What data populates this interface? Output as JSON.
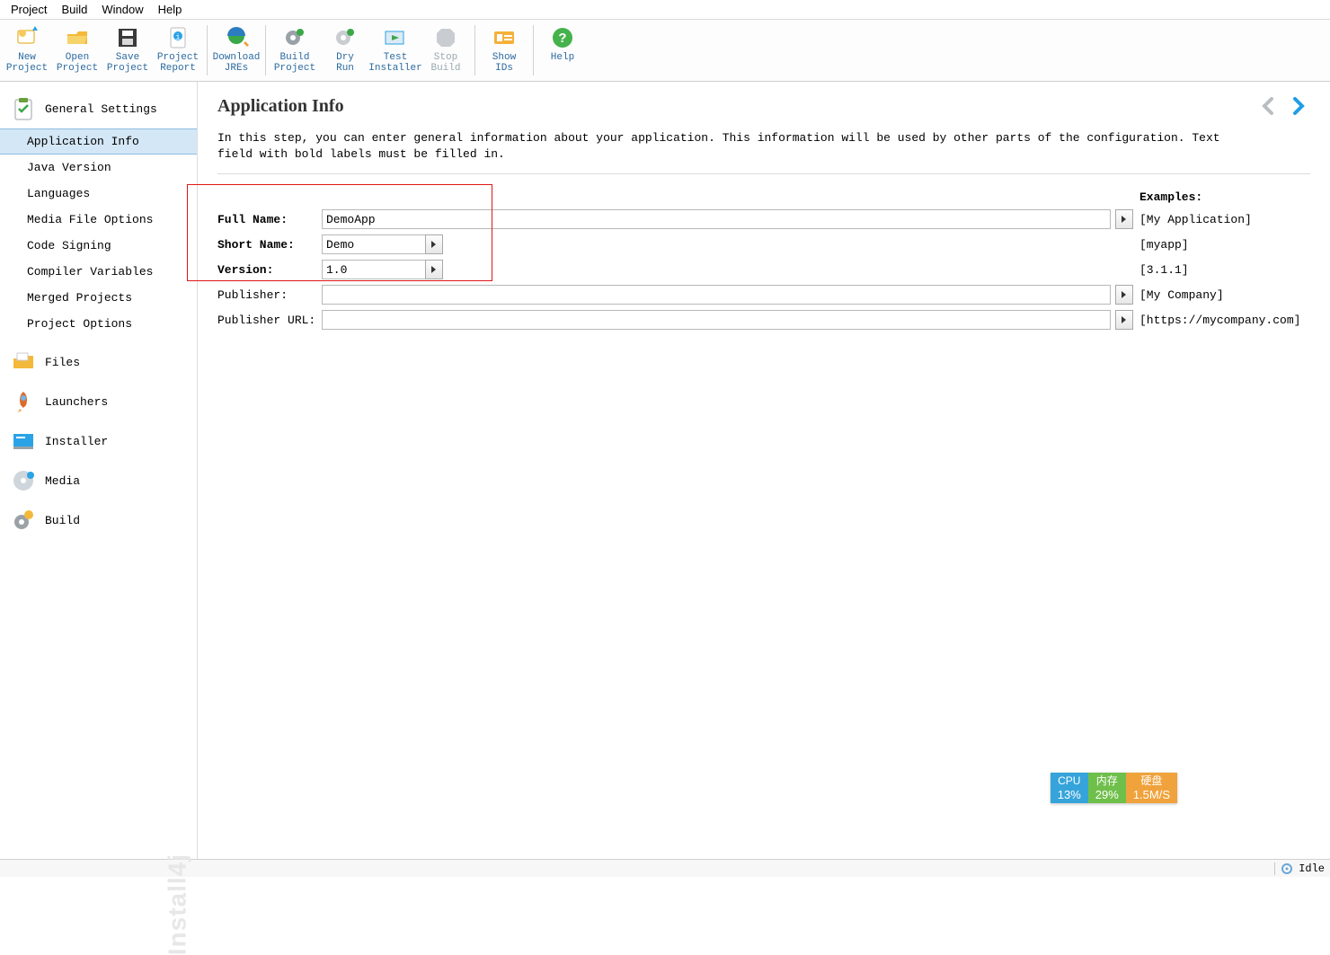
{
  "menu": [
    "Project",
    "Build",
    "Window",
    "Help"
  ],
  "toolbar": {
    "new": "New\nProject",
    "open": "Open\nProject",
    "save": "Save\nProject",
    "report": "Project\nReport",
    "jres": "Download\nJREs",
    "build": "Build\nProject",
    "dry": "Dry\nRun",
    "test": "Test\nInstaller",
    "stop": "Stop\nBuild",
    "ids": "Show\nIDs",
    "help": "Help"
  },
  "sidebar": {
    "sections": [
      {
        "key": "general",
        "label": "General Settings",
        "items": [
          "Application Info",
          "Java Version",
          "Languages",
          "Media File Options",
          "Code Signing",
          "Compiler Variables",
          "Merged Projects",
          "Project Options"
        ],
        "selected": 0
      },
      {
        "key": "files",
        "label": "Files"
      },
      {
        "key": "launchers",
        "label": "Launchers"
      },
      {
        "key": "installer",
        "label": "Installer"
      },
      {
        "key": "media",
        "label": "Media"
      },
      {
        "key": "build",
        "label": "Build"
      }
    ],
    "watermark": "Install4j"
  },
  "page": {
    "title": "Application Info",
    "desc": "In this step, you can enter general information about your application. This information will be used by other parts of the configuration. Text field with bold labels must be filled in."
  },
  "form": {
    "fullname": {
      "label": "Full Name:",
      "value": "DemoApp",
      "example": "[My Application]",
      "bold": true,
      "long": true
    },
    "shortname": {
      "label": "Short Name:",
      "value": "Demo",
      "example": "[myapp]",
      "bold": true
    },
    "version": {
      "label": "Version:",
      "value": "1.0",
      "example": "[3.1.1]",
      "bold": true
    },
    "publisher": {
      "label": "Publisher:",
      "value": "",
      "example": "[My Company]"
    },
    "puburl": {
      "label": "Publisher URL:",
      "value": "",
      "example": "[https://mycompany.com]"
    }
  },
  "examples_header": "Examples:",
  "perf": {
    "cpu": {
      "h": "CPU",
      "v": "13%"
    },
    "mem": {
      "h": "内存",
      "v": "29%"
    },
    "disk": {
      "h": "硬盘",
      "v": "1.5M/S"
    }
  },
  "status": {
    "idle": "Idle"
  }
}
